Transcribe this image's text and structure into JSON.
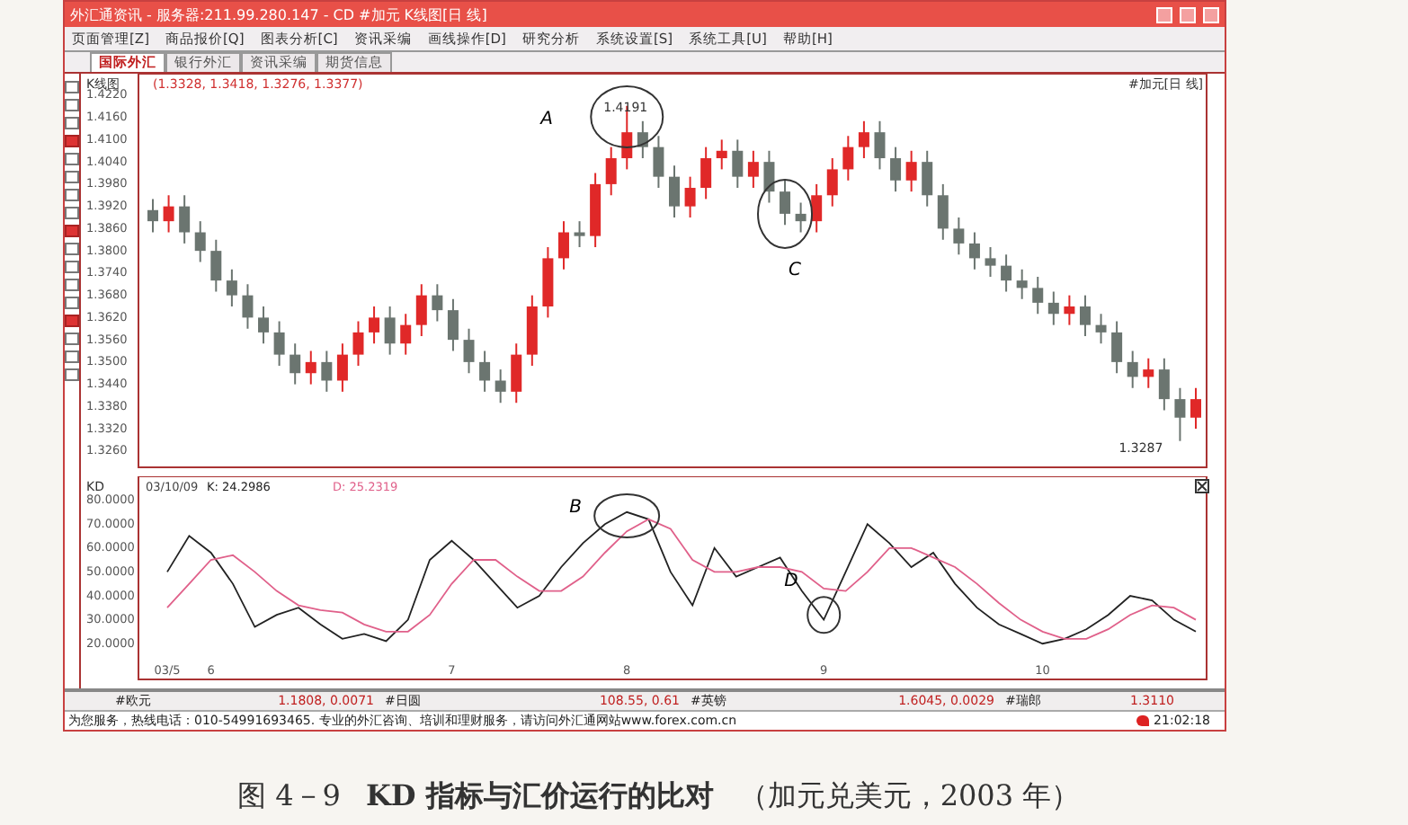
{
  "window": {
    "title": "外汇通资讯 - 服务器:211.99.280.147 - CD #加元 K线图[日 线]"
  },
  "menu": [
    "页面管理[Z]",
    "商品报价[Q]",
    "图表分析[C]",
    "资讯采编",
    "画线操作[D]",
    "研究分析",
    "系统设置[S]",
    "系统工具[U]",
    "帮助[H]"
  ],
  "tabs": [
    {
      "label": "国际外汇",
      "selected": true
    },
    {
      "label": "银行外汇",
      "selected": false
    },
    {
      "label": "资讯采编",
      "selected": false
    },
    {
      "label": "期货信息",
      "selected": false
    }
  ],
  "price_chart": {
    "header": "K线图",
    "quote": "(1.3328, 1.3418, 1.3276, 1.3377)",
    "symbol": "#加元[日 线]",
    "high_label": "1.4191",
    "low_label": "1.3287",
    "marks": [
      "A",
      "C"
    ],
    "chart_data": {
      "type": "candlestick",
      "categories": [
        null,
        null,
        null,
        null,
        null,
        null,
        null,
        null,
        null,
        null,
        null,
        null,
        null,
        null,
        null,
        null,
        null,
        null,
        null,
        null,
        null,
        null,
        null,
        null,
        null,
        null,
        null,
        null,
        null,
        null,
        null,
        null,
        null,
        null,
        null,
        null,
        null,
        null,
        null,
        null,
        null,
        null,
        null,
        null,
        null,
        null,
        null,
        null,
        null,
        null,
        null,
        null,
        null,
        null,
        null,
        null,
        null,
        null,
        null,
        null,
        null,
        null,
        null,
        null,
        null,
        null,
        null
      ],
      "ylim": [
        1.3216,
        1.4278
      ],
      "yticks": [
        {
          "value": 1.422,
          "label": "1.4220"
        },
        {
          "value": 1.416,
          "label": "1.4160"
        },
        {
          "value": 1.41,
          "label": "1.4100"
        },
        {
          "value": 1.404,
          "label": "1.4040"
        },
        {
          "value": 1.398,
          "label": "1.3980"
        },
        {
          "value": 1.392,
          "label": "1.3920"
        },
        {
          "value": 1.386,
          "label": "1.3860"
        },
        {
          "value": 1.38,
          "label": "1.3800"
        },
        {
          "value": 1.374,
          "label": "1.3740"
        },
        {
          "value": 1.368,
          "label": "1.3680"
        },
        {
          "value": 1.362,
          "label": "1.3620"
        },
        {
          "value": 1.356,
          "label": "1.3560"
        },
        {
          "value": 1.35,
          "label": "1.3500"
        },
        {
          "value": 1.344,
          "label": "1.3440"
        },
        {
          "value": 1.338,
          "label": "1.3380"
        },
        {
          "value": 1.332,
          "label": "1.3320"
        },
        {
          "value": 1.326,
          "label": "1.3260"
        }
      ],
      "ohlc": [
        [
          1.391,
          1.394,
          1.385,
          1.388
        ],
        [
          1.388,
          1.395,
          1.385,
          1.392
        ],
        [
          1.392,
          1.395,
          1.382,
          1.385
        ],
        [
          1.385,
          1.388,
          1.377,
          1.38
        ],
        [
          1.38,
          1.383,
          1.369,
          1.372
        ],
        [
          1.372,
          1.375,
          1.365,
          1.368
        ],
        [
          1.368,
          1.371,
          1.359,
          1.362
        ],
        [
          1.362,
          1.365,
          1.355,
          1.358
        ],
        [
          1.358,
          1.361,
          1.349,
          1.352
        ],
        [
          1.352,
          1.355,
          1.344,
          1.347
        ],
        [
          1.347,
          1.353,
          1.344,
          1.35
        ],
        [
          1.35,
          1.353,
          1.342,
          1.345
        ],
        [
          1.345,
          1.355,
          1.342,
          1.352
        ],
        [
          1.352,
          1.361,
          1.349,
          1.358
        ],
        [
          1.358,
          1.365,
          1.355,
          1.362
        ],
        [
          1.362,
          1.365,
          1.352,
          1.355
        ],
        [
          1.355,
          1.363,
          1.352,
          1.36
        ],
        [
          1.36,
          1.371,
          1.357,
          1.368
        ],
        [
          1.368,
          1.371,
          1.361,
          1.364
        ],
        [
          1.364,
          1.367,
          1.353,
          1.356
        ],
        [
          1.356,
          1.359,
          1.347,
          1.35
        ],
        [
          1.35,
          1.353,
          1.342,
          1.345
        ],
        [
          1.345,
          1.348,
          1.339,
          1.342
        ],
        [
          1.342,
          1.355,
          1.339,
          1.352
        ],
        [
          1.352,
          1.368,
          1.349,
          1.365
        ],
        [
          1.365,
          1.381,
          1.362,
          1.378
        ],
        [
          1.378,
          1.388,
          1.375,
          1.385
        ],
        [
          1.385,
          1.388,
          1.381,
          1.384
        ],
        [
          1.384,
          1.401,
          1.381,
          1.398
        ],
        [
          1.398,
          1.408,
          1.395,
          1.405
        ],
        [
          1.405,
          1.4191,
          1.402,
          1.412
        ],
        [
          1.412,
          1.415,
          1.405,
          1.408
        ],
        [
          1.408,
          1.411,
          1.397,
          1.4
        ],
        [
          1.4,
          1.403,
          1.389,
          1.392
        ],
        [
          1.392,
          1.4,
          1.389,
          1.397
        ],
        [
          1.397,
          1.408,
          1.394,
          1.405
        ],
        [
          1.405,
          1.41,
          1.402,
          1.407
        ],
        [
          1.407,
          1.41,
          1.397,
          1.4
        ],
        [
          1.4,
          1.407,
          1.397,
          1.404
        ],
        [
          1.404,
          1.407,
          1.393,
          1.396
        ],
        [
          1.396,
          1.399,
          1.387,
          1.39
        ],
        [
          1.39,
          1.393,
          1.385,
          1.388
        ],
        [
          1.388,
          1.398,
          1.385,
          1.395
        ],
        [
          1.395,
          1.405,
          1.392,
          1.402
        ],
        [
          1.402,
          1.411,
          1.399,
          1.408
        ],
        [
          1.408,
          1.415,
          1.405,
          1.412
        ],
        [
          1.412,
          1.415,
          1.402,
          1.405
        ],
        [
          1.405,
          1.408,
          1.396,
          1.399
        ],
        [
          1.399,
          1.407,
          1.396,
          1.404
        ],
        [
          1.404,
          1.407,
          1.392,
          1.395
        ],
        [
          1.395,
          1.398,
          1.383,
          1.386
        ],
        [
          1.386,
          1.389,
          1.379,
          1.382
        ],
        [
          1.382,
          1.385,
          1.375,
          1.378
        ],
        [
          1.378,
          1.381,
          1.373,
          1.376
        ],
        [
          1.376,
          1.379,
          1.369,
          1.372
        ],
        [
          1.372,
          1.375,
          1.367,
          1.37
        ],
        [
          1.37,
          1.373,
          1.363,
          1.366
        ],
        [
          1.366,
          1.369,
          1.36,
          1.363
        ],
        [
          1.363,
          1.368,
          1.36,
          1.365
        ],
        [
          1.365,
          1.368,
          1.357,
          1.36
        ],
        [
          1.36,
          1.363,
          1.355,
          1.358
        ],
        [
          1.358,
          1.361,
          1.347,
          1.35
        ],
        [
          1.35,
          1.353,
          1.343,
          1.346
        ],
        [
          1.346,
          1.351,
          1.343,
          1.348
        ],
        [
          1.348,
          1.351,
          1.337,
          1.34
        ],
        [
          1.34,
          1.343,
          1.3287,
          1.335
        ],
        [
          1.335,
          1.343,
          1.332,
          1.34
        ]
      ]
    }
  },
  "kd_panel": {
    "header": "KD",
    "date": "03/10/09",
    "readings": [
      ": 24.2986",
      ": 25.2319"
    ],
    "marks": [
      "B",
      "D"
    ],
    "chart_data": {
      "type": "line",
      "categories": [
        "03/5",
        null,
        "6",
        null,
        null,
        null,
        null,
        null,
        null,
        null,
        null,
        null,
        null,
        "7",
        null,
        null,
        null,
        null,
        null,
        null,
        null,
        "8",
        null,
        null,
        null,
        null,
        null,
        null,
        null,
        null,
        "9",
        null,
        null,
        null,
        null,
        null,
        null,
        null,
        null,
        null,
        "10",
        null,
        null,
        null,
        null,
        null,
        null,
        null
      ],
      "yticks": [
        {
          "value": 80,
          "label": "80.0000"
        },
        {
          "value": 70,
          "label": "70.0000"
        },
        {
          "value": 60,
          "label": "60.0000"
        },
        {
          "value": 50,
          "label": "50.0000"
        },
        {
          "value": 40,
          "label": "40.0000"
        },
        {
          "value": 30,
          "label": "30.0000"
        },
        {
          "value": 20,
          "label": "20.0000"
        }
      ],
      "ylim": [
        5,
        90
      ],
      "series": [
        {
          "name": "K",
          "color": "#222222",
          "values": [
            50,
            65,
            58,
            45,
            27,
            32,
            35,
            28,
            22,
            24,
            21,
            30,
            55,
            63,
            55,
            45,
            35,
            40,
            52,
            62,
            70,
            75,
            72,
            50,
            36,
            60,
            48,
            52,
            56,
            42,
            30,
            50,
            70,
            62,
            52,
            58,
            45,
            35,
            28,
            24,
            20,
            22,
            26,
            32,
            40,
            38,
            30,
            25
          ]
        },
        {
          "name": "D",
          "color": "#e0608a",
          "values": [
            35,
            45,
            55,
            57,
            50,
            42,
            36,
            34,
            33,
            28,
            25,
            25,
            32,
            45,
            55,
            55,
            48,
            42,
            42,
            48,
            58,
            67,
            72,
            68,
            55,
            50,
            50,
            52,
            52,
            50,
            43,
            42,
            50,
            60,
            60,
            56,
            52,
            45,
            37,
            30,
            25,
            22,
            22,
            26,
            32,
            36,
            35,
            30
          ]
        }
      ]
    }
  },
  "quotes": [
    {
      "symbol": "#欧元",
      "value": "1.1808, 0.0071"
    },
    {
      "symbol": "#日圆",
      "value": "108.55, 0.61"
    },
    {
      "symbol": "#英镑",
      "value": "1.6045, 0.0029"
    },
    {
      "symbol": "#瑞郎",
      "value": "1.3110"
    }
  ],
  "status_bar": {
    "message": "为您服务，热线电话：010-54991693465. 专业的外汇咨询、培训和理财服务，请访问外汇通网站www.forex.com.cn",
    "time": "21:02:18"
  },
  "caption": {
    "figure": "图 4－9",
    "title": "KD 指标与汇价运行的比对",
    "note": "（加元兑美元，2003 年）"
  }
}
